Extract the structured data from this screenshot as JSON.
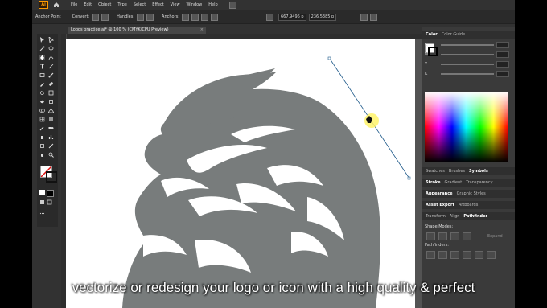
{
  "app": {
    "logo_text": "Ai",
    "menu": [
      "File",
      "Edit",
      "Object",
      "Type",
      "Select",
      "Effect",
      "View",
      "Window",
      "Help"
    ]
  },
  "control_bar": {
    "anchor_label": "Anchor Point",
    "convert_label": "Convert:",
    "handles_label": "Handles:",
    "anchors_label": "Anchors:",
    "x_value": "667.9496 p",
    "y_value": "236.5385 p"
  },
  "document": {
    "tab_title": "Logos practice.ai* @ 100 % (CMYK/CPU Preview)",
    "close": "×"
  },
  "panels": {
    "color_tabs": [
      "Color",
      "Color Guide"
    ],
    "sliders": [
      "C",
      "M",
      "Y",
      "K"
    ],
    "swatch_tabs": [
      "Swatches",
      "Brushes",
      "Symbols"
    ],
    "stroke_tabs": [
      "Stroke",
      "Gradient",
      "Transparency"
    ],
    "appearance_tabs": [
      "Appearance",
      "Graphic Styles"
    ],
    "asset_tabs": [
      "Asset Export",
      "Artboards"
    ],
    "transform_tabs": [
      "Transform",
      "Align",
      "Pathfinder"
    ],
    "shape_modes_label": "Shape Modes:",
    "expand_label": "Expand",
    "pathfinders_label": "Pathfinders:"
  },
  "colors": {
    "app_bg": "#323232",
    "canvas": "#ffffff",
    "logo_gray": "#787c7c",
    "accent_orange": "#ff9a00"
  },
  "subtitle": "vectorize or redesign your logo or icon with a high quality & perfect"
}
